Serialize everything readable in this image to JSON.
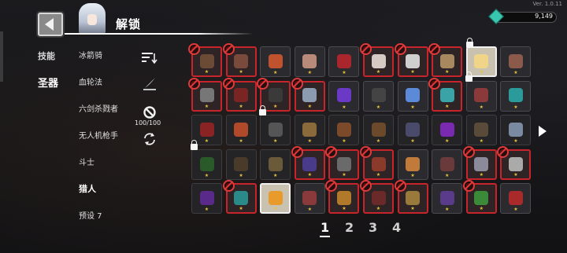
{
  "version": "Ver. 1.0.11",
  "title": "解锁",
  "currency": {
    "value": "9,149",
    "icon": "gem-icon",
    "color": "#39c7b0"
  },
  "categories": [
    {
      "label": "技能",
      "active": false
    },
    {
      "label": "圣器",
      "active": true
    }
  ],
  "subcategories": [
    {
      "label": "冰箭骑",
      "active": false
    },
    {
      "label": "血轮法",
      "active": false
    },
    {
      "label": "六剑杀戮者",
      "active": false
    },
    {
      "label": "无人机枪手",
      "active": false
    },
    {
      "label": "斗士",
      "active": false
    },
    {
      "label": "猎人",
      "active": true
    },
    {
      "label": "预设 7",
      "active": false
    }
  ],
  "tools": {
    "sort_icon": "sort-icon",
    "filter_icon": "quill-icon",
    "ban_icon": "ban-icon",
    "ban_count": "100/100",
    "reset_icon": "refresh-icon"
  },
  "colors": {
    "locked_border": "#c8242c",
    "star": "#e8c23a",
    "ban": "#e03a3a"
  },
  "grid": {
    "rows": 5,
    "cols": 10,
    "cells": [
      {
        "color": "#6b4a36",
        "state": "locked"
      },
      {
        "color": "#7a4b3c",
        "state": "locked"
      },
      {
        "color": "#c0522e",
        "state": "normal"
      },
      {
        "color": "#b78a7a",
        "state": "normal"
      },
      {
        "color": "#a8262c",
        "state": "normal"
      },
      {
        "color": "#d7c9c4",
        "state": "locked"
      },
      {
        "color": "#cfcfcf",
        "state": "locked"
      },
      {
        "color": "#a8885f",
        "state": "locked"
      },
      {
        "color": "#f0d488",
        "state": "selected-padlock"
      },
      {
        "color": "#8c5a4a",
        "state": "normal"
      },
      {
        "color": "#777777",
        "state": "locked"
      },
      {
        "color": "#7a2424",
        "state": "locked"
      },
      {
        "color": "#3a3a3a",
        "state": "locked"
      },
      {
        "color": "#8b9bb0",
        "state": "locked"
      },
      {
        "color": "#6a3ac7",
        "state": "normal"
      },
      {
        "color": "#444444",
        "state": "normal"
      },
      {
        "color": "#5b8ad9",
        "state": "normal"
      },
      {
        "color": "#3aa3a8",
        "state": "locked"
      },
      {
        "color": "#8a3a3a",
        "state": "padlock"
      },
      {
        "color": "#2a9a9a",
        "state": "normal"
      },
      {
        "color": "#8a2424",
        "state": "dim"
      },
      {
        "color": "#b04a2a",
        "state": "dim"
      },
      {
        "color": "#555555",
        "state": "dim-padlock"
      },
      {
        "color": "#8a6a3a",
        "state": "dim"
      },
      {
        "color": "#7a4a2a",
        "state": "dim"
      },
      {
        "color": "#6a4a2a",
        "state": "dim"
      },
      {
        "color": "#4a4a6a",
        "state": "dim"
      },
      {
        "color": "#7a2ab0",
        "state": "dim"
      },
      {
        "color": "#5a4a3a",
        "state": "dim"
      },
      {
        "color": "#7a8aa0",
        "state": "dim"
      },
      {
        "color": "#2a5a2a",
        "state": "dim-padlock"
      },
      {
        "color": "#4a3a2a",
        "state": "dim"
      },
      {
        "color": "#6a5a3a",
        "state": "dim"
      },
      {
        "color": "#4a3a8a",
        "state": "locked"
      },
      {
        "color": "#6a6a6a",
        "state": "locked"
      },
      {
        "color": "#8a3a2a",
        "state": "locked"
      },
      {
        "color": "#c07a3a",
        "state": "normal"
      },
      {
        "color": "#6a3a3a",
        "state": "normal"
      },
      {
        "color": "#8a8a9a",
        "state": "locked"
      },
      {
        "color": "#aaaaaa",
        "state": "locked"
      },
      {
        "color": "#5a2a8a",
        "state": "dim"
      },
      {
        "color": "#2a8a8a",
        "state": "locked"
      },
      {
        "color": "#e89a2a",
        "state": "selected"
      },
      {
        "color": "#8a3a3a",
        "state": "normal"
      },
      {
        "color": "#b07a2a",
        "state": "locked"
      },
      {
        "color": "#6a2a2a",
        "state": "locked"
      },
      {
        "color": "#9a7a3a",
        "state": "locked"
      },
      {
        "color": "#5a3a8a",
        "state": "normal"
      },
      {
        "color": "#3a8a3a",
        "state": "locked"
      },
      {
        "color": "#a82a2a",
        "state": "normal"
      }
    ]
  },
  "pager": {
    "pages": [
      "1",
      "2",
      "3",
      "4"
    ],
    "active": "1"
  }
}
